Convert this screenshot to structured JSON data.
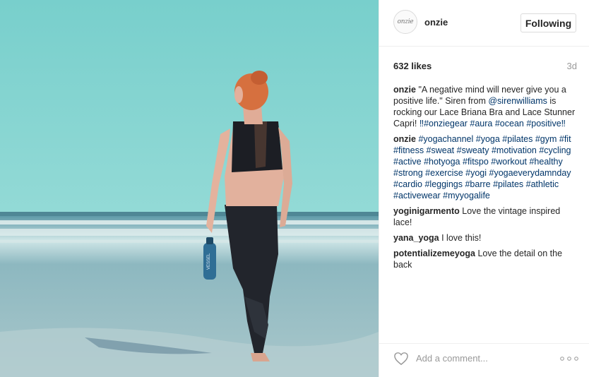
{
  "photo": {
    "colors": {
      "sky": "#7ed3d1",
      "ocean": "#6aa7b2",
      "sand": "#9ec1c7",
      "hair": "#c7643c"
    },
    "bottle_text": "VESSEL"
  },
  "header": {
    "avatar_text": "onzie",
    "username": "onzie",
    "follow_label": "Following"
  },
  "stats": {
    "likes": "632 likes",
    "time_ago": "3d"
  },
  "caption": {
    "author": "onzie",
    "text_1": "\"A negative mind will never give you a positive life.\" Siren from ",
    "mention": "@sirenwilliams",
    "text_2": " is rocking our Lace Briana Bra and Lace Stunner Capri! ",
    "tags_line": "‼#onziegear #aura #ocean #positive‼"
  },
  "hashtag_comment": {
    "author": "onzie",
    "tags": "#yogachannel #yoga #pilates #gym #fit #fitness #sweat #sweaty #motivation #cycling #active #hotyoga #fitspo #workout #healthy #strong #exercise #yogi #yogaeverydamnday #cardio #leggings #barre #pilates #athletic #activewear #myyogalife"
  },
  "comments": [
    {
      "author": "yoginigarmento",
      "text": "Love the vintage inspired lace!"
    },
    {
      "author": "yana_yoga",
      "text": "I love this!"
    },
    {
      "author": "potentializemeyoga",
      "text": "Love the detail on the back"
    }
  ],
  "footer": {
    "heart_icon": "heart-outline-icon",
    "comment_placeholder": "Add a comment...",
    "more_icon": "more-options-icon"
  }
}
